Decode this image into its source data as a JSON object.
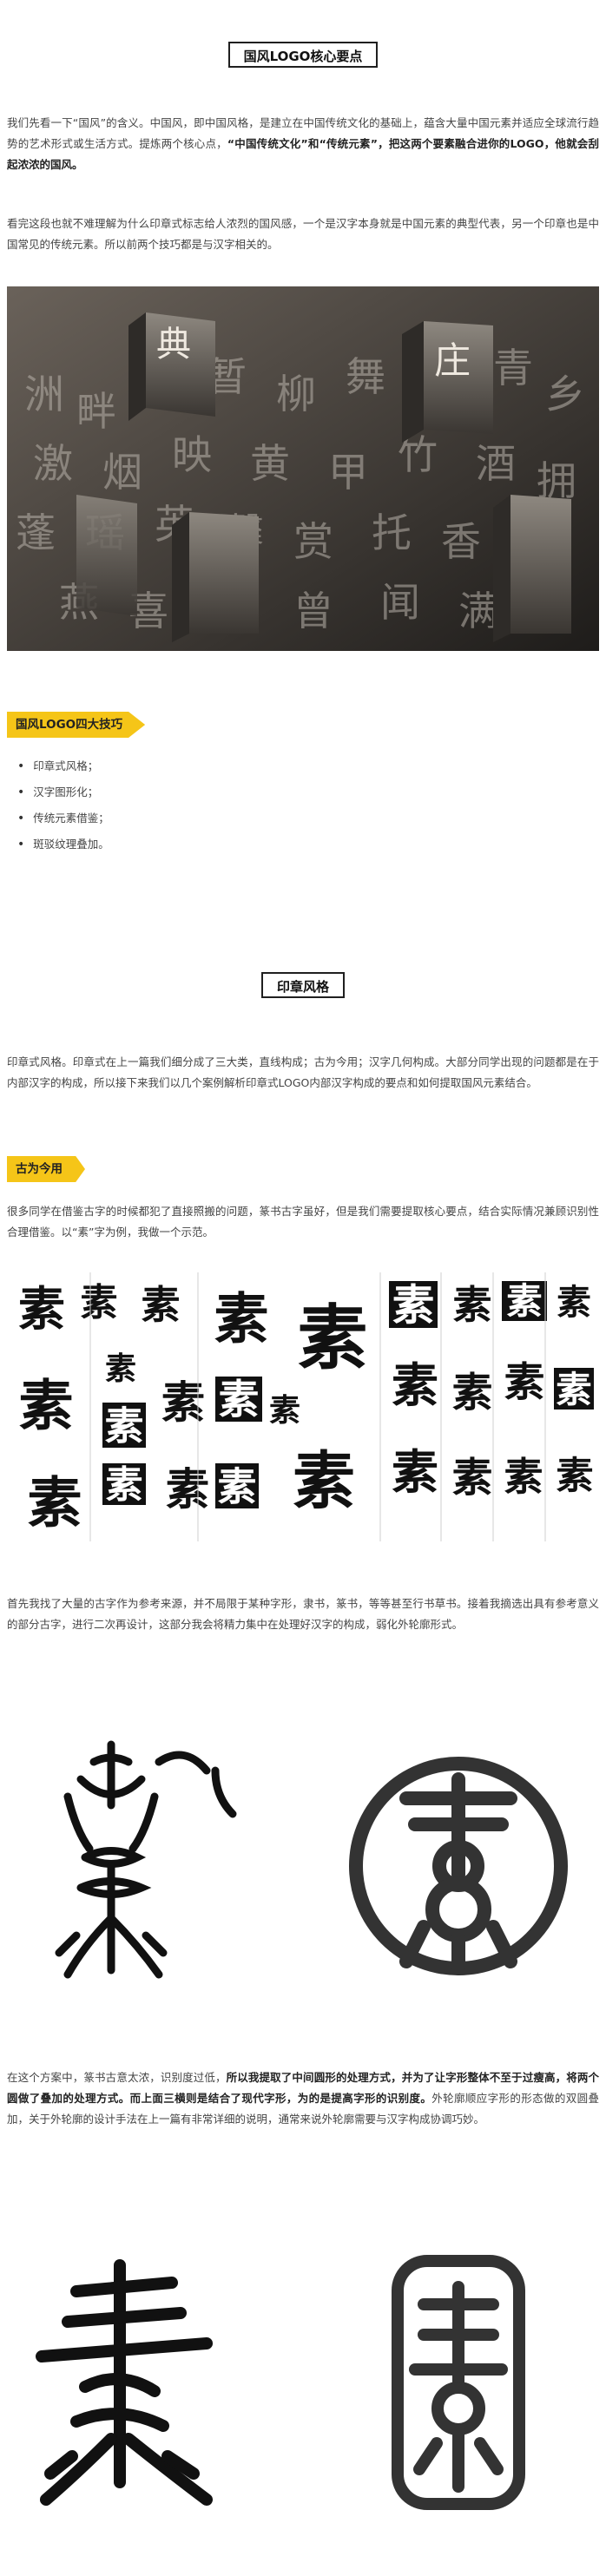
{
  "section1": {
    "title": "国风LOGO核心要点"
  },
  "intro": {
    "p1_a": "我们先看一下“国风”的含义。中国风，即中国风格，是建立在中国传统文化的基础上，蕴含大量中国元素并适应全球流行趋势的艺术形式或生活方式。提炼两个核心点，",
    "p1_b": "“中国传统文化”和“传统元素”，把这两个要素融合进你的LOGO，他就会刮起浓浓的国风。",
    "p2": "看完这段也就不难理解为什么印章式标志给人浓烈的国风感，一个是汉字本身就是中国元素的典型代表，另一个印章也是中国常见的传统元素。所以前两个技巧都是与汉字相关的。"
  },
  "tips": {
    "tag": "国风LOGO四大技巧",
    "items": [
      "印章式风格；",
      "汉字图形化；",
      "传统元素借鉴；",
      "斑驳纹理叠加。"
    ]
  },
  "section2": {
    "title": "印章风格"
  },
  "seal": {
    "p1": "印章式风格。印章式在上一篇我们细分成了三大类，直线构成；古为今用；汉字几何构成。大部分同学出现的问题都是在于内部汉字的构成，所以接下来我们以几个案例解析印章式LOGO内部汉字构成的要点和如何提取国风元素结合。",
    "tag": "古为今用",
    "p2": "很多同学在借鉴古字的时候都犯了直接照搬的问题，篆书古字虽好，但是我们需要提取核心要点，结合实际情况兼顾识别性合理借鉴。以“素”字为例，我做一个示范。",
    "glyph": "素",
    "p3": "首先我找了大量的古字作为参考来源，并不局限于某种字形，隶书，篆书，等等甚至行书草书。接着我摘选出具有参考意义的部分古字，进行二次再设计，这部分我会将精力集中在处理好汉字的构成，弱化外轮廓形式。",
    "p4_a": "在这个方案中，篆书古意太浓，识别度过低，",
    "p4_b": "所以我提取了中间圆形的处理方式，并为了让字形整体不至于过瘦高，将两个圆做了叠加的处理方式。而上面三横则是结合了现代字形，为的是提高字形的识别度。",
    "p4_c": "外轮廓顺应字形的形态做的双圆叠加，关于外轮廓的设计手法在上一篇有非常详细的说明，通常来说外轮廓需要与汉字构成协调巧妙。"
  },
  "colors": {
    "accent": "#f5c518",
    "text": "#444444",
    "dark": "#1f1f1f"
  }
}
